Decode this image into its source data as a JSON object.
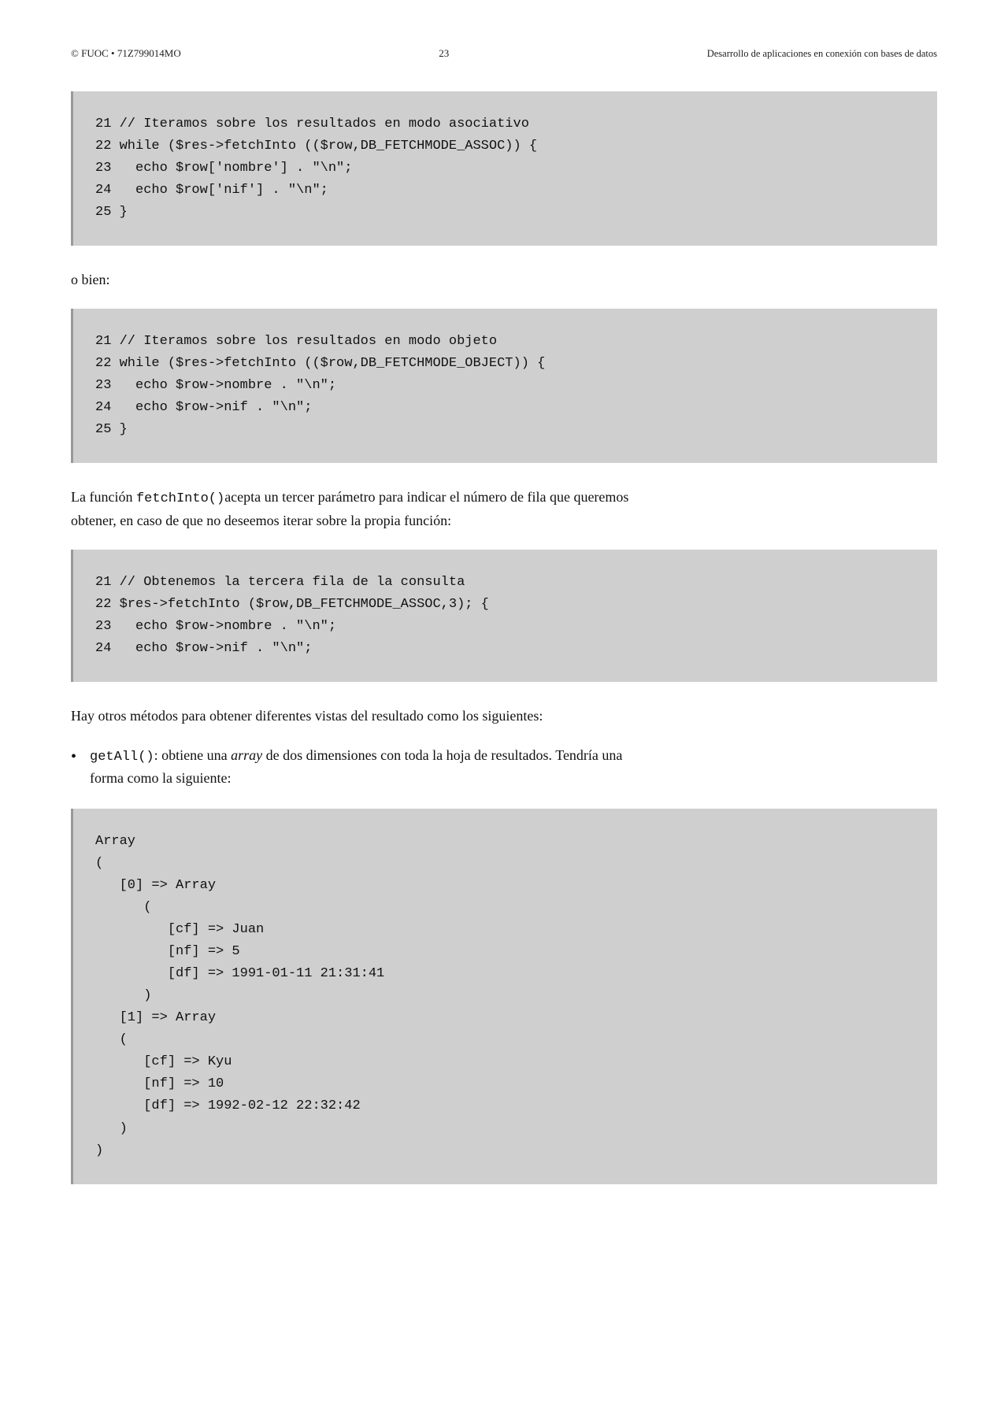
{
  "header": {
    "left": "© FUOC • 71Z799014MO",
    "center": "23",
    "right": "Desarrollo de aplicaciones en conexión con bases de datos"
  },
  "code1": "21 // Iteramos sobre los resultados en modo asociativo\n22 while ($res->fetchInto (($row,DB_FETCHMODE_ASSOC)) {\n23   echo $row['nombre'] . \"\\n\";\n24   echo $row['nif'] . \"\\n\";\n25 }",
  "para1": "o bien:",
  "code2": "21 // Iteramos sobre los resultados en modo objeto\n22 while ($res->fetchInto (($row,DB_FETCHMODE_OBJECT)) {\n23   echo $row->nombre . \"\\n\";\n24   echo $row->nif . \"\\n\";\n25 }",
  "para2_pre": "La función ",
  "para2_code": "fetchInto()",
  "para2_post": "acepta un tercer parámetro para indicar el número de fila que queremos obtener, en caso de que no deseemos iterar sobre la propia función:",
  "code3": "21 // Obtenemos la tercera fila de la consulta\n22 $res->fetchInto ($row,DB_FETCHMODE_ASSOC,3); {\n23   echo $row->nombre . \"\\n\";\n24   echo $row->nif . \"\\n\";",
  "para3": "Hay otros métodos para obtener diferentes vistas del resultado como los siguientes:",
  "bullet_code": "getAll()",
  "bullet_text_a": ": obtiene una ",
  "bullet_em": "array",
  "bullet_text_b": " de dos dimensiones con toda la hoja de resultados. Tendría una forma como la siguiente:",
  "code4": "Array\n(\n   [0] => Array\n      (\n         [cf] => Juan\n         [nf] => 5\n         [df] => 1991-01-11 21:31:41\n      )\n   [1] => Array\n   (\n      [cf] => Kyu\n      [nf] => 10\n      [df] => 1992-02-12 22:32:42\n   )\n)"
}
